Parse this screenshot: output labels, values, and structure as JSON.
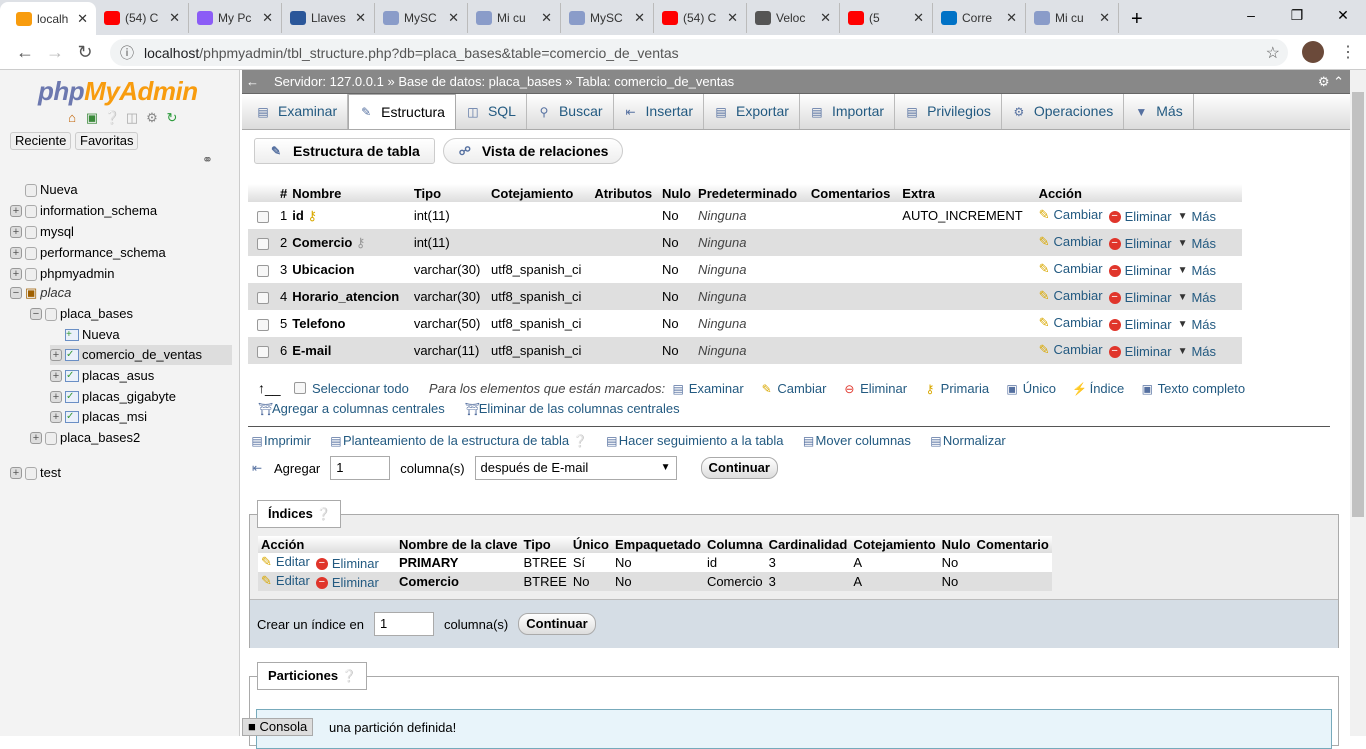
{
  "browser": {
    "tabs": [
      {
        "title": "localh",
        "icon": "phpmyadmin-icon",
        "color": "#f89c0e",
        "active": true
      },
      {
        "title": "(54) C",
        "icon": "youtube-icon",
        "color": "#ff0000"
      },
      {
        "title": "My Pc",
        "icon": "feather-icon",
        "color": "#8b5cf6"
      },
      {
        "title": "Llaves",
        "icon": "word-icon",
        "color": "#2b579a"
      },
      {
        "title": "MySC",
        "icon": "braces-icon",
        "color": "#8a9cc9"
      },
      {
        "title": "Mi cu",
        "icon": "braces-icon",
        "color": "#8a9cc9"
      },
      {
        "title": "MySC",
        "icon": "braces-icon",
        "color": "#8a9cc9"
      },
      {
        "title": "(54) C",
        "icon": "youtube-icon",
        "color": "#ff0000"
      },
      {
        "title": "Veloc",
        "icon": "globe-icon",
        "color": "#555555"
      },
      {
        "title": "(5",
        "icon": "youtube-icon",
        "color": "#ff0000"
      },
      {
        "title": "Corre",
        "icon": "outlook-icon",
        "color": "#0072c6"
      },
      {
        "title": "Mi cu",
        "icon": "braces-icon",
        "color": "#8a9cc9"
      }
    ],
    "url_host": "localhost",
    "url_path": "/phpmyadmin/tbl_structure.php?db=placa_bases&table=comercio_de_ventas"
  },
  "sidebar": {
    "logo_php": "php",
    "logo_myadmin": "MyAdmin",
    "recent": "Reciente",
    "favorites": "Favoritas",
    "tree": [
      "Nueva",
      "information_schema",
      "mysql",
      "performance_schema",
      "phpmyadmin",
      "placa",
      "placa_bases",
      "Nueva",
      "comercio_de_ventas",
      "placas_asus",
      "placas_gigabyte",
      "placas_msi",
      "placa_bases2",
      "test"
    ]
  },
  "breadcrumb": {
    "server": "Servidor: 127.0.0.1",
    "db": "Base de datos: placa_bases",
    "table": "Tabla: comercio_de_ventas"
  },
  "tabs": [
    "Examinar",
    "Estructura",
    "SQL",
    "Buscar",
    "Insertar",
    "Exportar",
    "Importar",
    "Privilegios",
    "Operaciones",
    "Más"
  ],
  "active_tab": "Estructura",
  "subtabs": [
    "Estructura de tabla",
    "Vista de relaciones"
  ],
  "structure": {
    "headers": [
      "#",
      "Nombre",
      "Tipo",
      "Cotejamiento",
      "Atributos",
      "Nulo",
      "Predeterminado",
      "Comentarios",
      "Extra",
      "Acción"
    ],
    "rows": [
      {
        "n": "1",
        "name": "id",
        "type": "int(11)",
        "coll": "",
        "nulo": "No",
        "def": "Ninguna",
        "extra": "AUTO_INCREMENT",
        "key": "primary"
      },
      {
        "n": "2",
        "name": "Comercio",
        "type": "int(11)",
        "coll": "",
        "nulo": "No",
        "def": "Ninguna",
        "extra": "",
        "key": "index"
      },
      {
        "n": "3",
        "name": "Ubicacion",
        "type": "varchar(30)",
        "coll": "utf8_spanish_ci",
        "nulo": "No",
        "def": "Ninguna",
        "extra": ""
      },
      {
        "n": "4",
        "name": "Horario_atencion",
        "type": "varchar(30)",
        "coll": "utf8_spanish_ci",
        "nulo": "No",
        "def": "Ninguna",
        "extra": ""
      },
      {
        "n": "5",
        "name": "Telefono",
        "type": "varchar(50)",
        "coll": "utf8_spanish_ci",
        "nulo": "No",
        "def": "Ninguna",
        "extra": ""
      },
      {
        "n": "6",
        "name": "E-mail",
        "type": "varchar(11)",
        "coll": "utf8_spanish_ci",
        "nulo": "No",
        "def": "Ninguna",
        "extra": ""
      }
    ],
    "actions": [
      "Cambiar",
      "Eliminar",
      "Más"
    ]
  },
  "bulk": {
    "select_all": "Seleccionar todo",
    "marked": "Para los elementos que están marcados:",
    "actions": [
      "Examinar",
      "Cambiar",
      "Eliminar",
      "Primaria",
      "Único",
      "Índice",
      "Texto completo"
    ],
    "add_central": "Agregar a columnas centrales",
    "remove_central": "Eliminar de las columnas centrales"
  },
  "tools": [
    "Imprimir",
    "Planteamiento de la estructura de tabla",
    "Hacer seguimiento a la tabla",
    "Mover columnas",
    "Normalizar"
  ],
  "add": {
    "label": "Agregar",
    "count": "1",
    "unit": "columna(s)",
    "position": "después de E-mail",
    "go": "Continuar"
  },
  "indexes": {
    "legend": "Índices",
    "headers": [
      "Acción",
      "Nombre de la clave",
      "Tipo",
      "Único",
      "Empaquetado",
      "Columna",
      "Cardinalidad",
      "Cotejamiento",
      "Nulo",
      "Comentario"
    ],
    "edit": "Editar",
    "drop": "Eliminar",
    "rows": [
      {
        "name": "PRIMARY",
        "type": "BTREE",
        "unique": "Sí",
        "packed": "No",
        "col": "id",
        "card": "3",
        "coll": "A",
        "nulo": "No"
      },
      {
        "name": "Comercio",
        "type": "BTREE",
        "unique": "No",
        "packed": "No",
        "col": "Comercio",
        "card": "3",
        "coll": "A",
        "nulo": "No"
      }
    ],
    "create_label": "Crear un índice en",
    "create_count": "1",
    "create_unit": "columna(s)",
    "go": "Continuar"
  },
  "partitions": {
    "legend": "Particiones",
    "message": "una partición definida!"
  },
  "console": "Consola"
}
